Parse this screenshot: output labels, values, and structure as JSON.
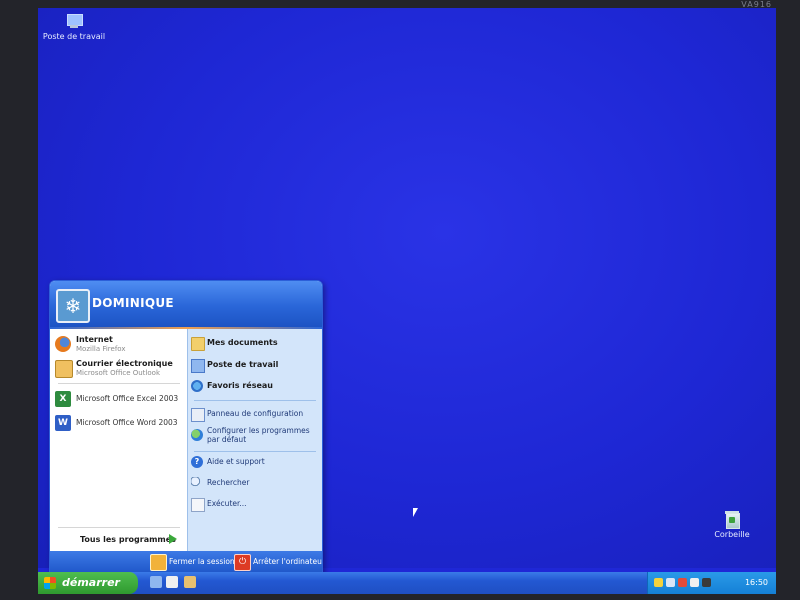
{
  "monitor": {
    "brand": "VA916"
  },
  "desktop": {
    "icons": [
      {
        "label": "Poste de travail",
        "icon": "my-computer-icon"
      },
      {
        "label": "Corbeille",
        "icon": "recycle-bin-icon"
      }
    ]
  },
  "start_menu": {
    "user_name": "DOMINIQUE",
    "pinned": [
      {
        "title": "Internet",
        "subtitle": "Mozilla Firefox",
        "icon": "firefox-icon"
      },
      {
        "title": "Courrier électronique",
        "subtitle": "Microsoft Office Outlook",
        "icon": "mail-icon"
      }
    ],
    "recent": [
      {
        "label": "Microsoft Office Excel 2003",
        "icon": "excel-icon"
      },
      {
        "label": "Microsoft Office Word 2003",
        "icon": "word-icon"
      }
    ],
    "all_programs": "Tous les programmes",
    "places": [
      {
        "label": "Mes documents",
        "icon": "folder-icon"
      },
      {
        "label": "Poste de travail",
        "icon": "computer-icon"
      },
      {
        "label": "Favoris réseau",
        "icon": "network-icon"
      }
    ],
    "system": [
      {
        "label": "Panneau de configuration",
        "icon": "control-panel-icon"
      },
      {
        "label": "Configurer les programmes par défaut",
        "icon": "default-programs-icon"
      }
    ],
    "tools": [
      {
        "label": "Aide et support",
        "icon": "help-icon"
      },
      {
        "label": "Rechercher",
        "icon": "search-icon"
      },
      {
        "label": "Exécuter...",
        "icon": "run-icon"
      }
    ],
    "footer": {
      "logoff": "Fermer la session",
      "shutdown": "Arrêter l'ordinateur"
    }
  },
  "taskbar": {
    "start_label": "démarrer",
    "quick_launch": [
      "show-desktop-icon",
      "internet-explorer-icon",
      "media-player-icon"
    ],
    "tray_icons": [
      "security-shield-icon",
      "network-icon",
      "volume-icon",
      "tray-app-icon",
      "safely-remove-icon"
    ],
    "clock": "16:50"
  },
  "colors": {
    "desktop": "#1f27d6",
    "taskbar": "#2358d2",
    "start_button": "#3aa83a",
    "start_menu_header": "#2a66d8",
    "start_menu_right": "#d3e5fa"
  }
}
